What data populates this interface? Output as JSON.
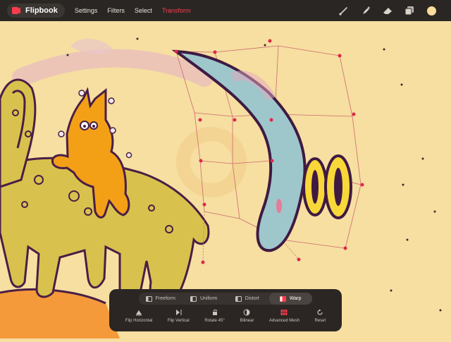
{
  "app": {
    "name": "Flipbook"
  },
  "menu": [
    {
      "label": "Settings",
      "active": false
    },
    {
      "label": "Filters",
      "active": false
    },
    {
      "label": "Select",
      "active": false
    },
    {
      "label": "Transform",
      "active": true
    }
  ],
  "tools": [
    "brush-icon",
    "smudge-icon",
    "eraser-icon",
    "layers-icon",
    "color-swatch"
  ],
  "colors": {
    "accent": "#ff3b4d",
    "toolbar": "#2a2623",
    "canvas": "#f6dfa1",
    "current_color": "#f8dd9b"
  },
  "transform": {
    "modes": [
      {
        "label": "Freeform",
        "active": false
      },
      {
        "label": "Uniform",
        "active": false
      },
      {
        "label": "Distort",
        "active": false
      },
      {
        "label": "Warp",
        "active": true
      }
    ],
    "actions": [
      {
        "label": "Flip Horizontal",
        "icon": "flip-horizontal-icon"
      },
      {
        "label": "Flip Vertical",
        "icon": "flip-vertical-icon"
      },
      {
        "label": "Rotate 45°",
        "icon": "rotate-icon"
      },
      {
        "label": "Bilinear",
        "icon": "bilinear-icon"
      },
      {
        "label": "Advanced Mesh",
        "icon": "mesh-icon"
      },
      {
        "label": "Reset",
        "icon": "reset-icon"
      }
    ]
  }
}
